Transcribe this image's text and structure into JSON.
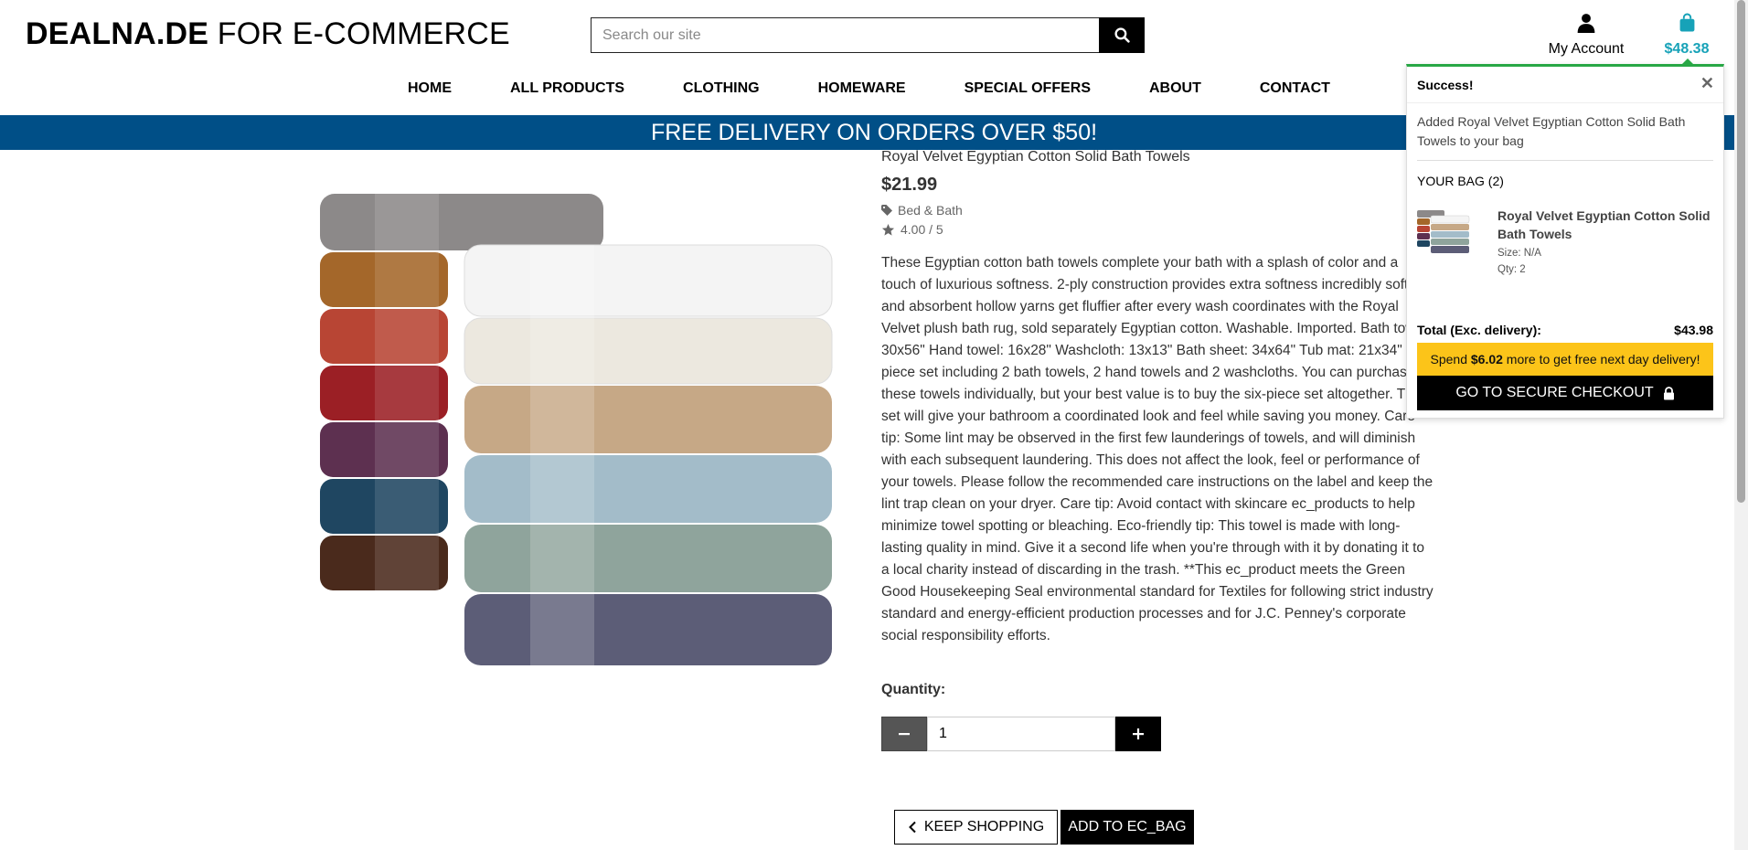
{
  "header": {
    "logo_bold": "DEALNA.DE",
    "logo_rest": " FOR E-COMMERCE",
    "search_placeholder": "Search our site",
    "account_label": "My Account",
    "bag_total": "$48.38"
  },
  "nav": {
    "items": [
      "HOME",
      "ALL PRODUCTS",
      "CLOTHING",
      "HOMEWARE",
      "SPECIAL OFFERS",
      "ABOUT",
      "CONTACT"
    ]
  },
  "banner": "FREE DELIVERY ON ORDERS OVER $50!",
  "product": {
    "name": "Royal Velvet Egyptian Cotton Solid Bath Towels",
    "price": "$21.99",
    "category": "Bed & Bath",
    "rating": "4.00 / 5",
    "description": "These Egyptian cotton bath towels complete your bath with a splash of color and a touch of luxurious softness. 2-ply construction provides extra softness incredibly soft and absorbent hollow yarns get fluffier after every wash coordinates with the Royal Velvet plush bath rug, sold separately Egyptian cotton. Washable. Imported. Bath towel: 30x56\" Hand towel: 16x28\" Washcloth: 13x13\" Bath sheet: 34x64\" Tub mat: 21x34\" 6-piece set including 2 bath towels, 2 hand towels and 2 washcloths. You can purchase these towels individually, but your best value is to buy the six-piece set altogether. This set will give your bathroom a coordinated look and feel while saving you money. Care tip: Some lint may be observed in the first few launderings of towels, and will diminish with each subsequent laundering. This does not affect the look, feel or performance of your towels. Please follow the recommended care instructions on the label and keep the lint trap clean on your dryer. Care tip: Avoid contact with skincare ec_products to help minimize towel spotting or bleaching. Eco-friendly tip: This towel is made with long-lasting quality in mind. Give it a second life when you're through with it by donating it to a local charity instead of discarding in the trash. **This ec_product meets the Green Good Housekeeping Seal environmental standard for Textiles for following strict industry standard and energy-efficient production processes and for J.C. Penney's corporate social responsibility efforts.",
    "quantity_label": "Quantity:",
    "quantity_value": "1",
    "keep_shopping": "KEEP SHOPPING",
    "add_to_bag": "ADD TO EC_BAG"
  },
  "toast": {
    "title": "Success!",
    "message": "Added Royal Velvet Egyptian Cotton Solid Bath Towels to your bag",
    "bag_heading": "YOUR BAG (2)",
    "item_name": "Royal Velvet Egyptian Cotton Solid Bath Towels",
    "item_size": "Size: N/A",
    "item_qty": "Qty: 2",
    "total_label": "Total (Exc. delivery):",
    "total_value": "$43.98",
    "spend_prefix": "Spend ",
    "spend_amount": "$6.02",
    "spend_suffix": " more to get free next day delivery!",
    "checkout": "GO TO SECURE CHECKOUT"
  },
  "colors": {
    "banner": "#004f87",
    "bag_accent": "#17a2b8",
    "success": "#28a745",
    "spend_bar": "#fcc419"
  },
  "icons": [
    "search-icon",
    "user-icon",
    "shopping-bag-icon",
    "tag-icon",
    "star-icon",
    "close-icon",
    "minus-icon",
    "plus-icon",
    "chevron-left-icon",
    "lock-icon"
  ]
}
